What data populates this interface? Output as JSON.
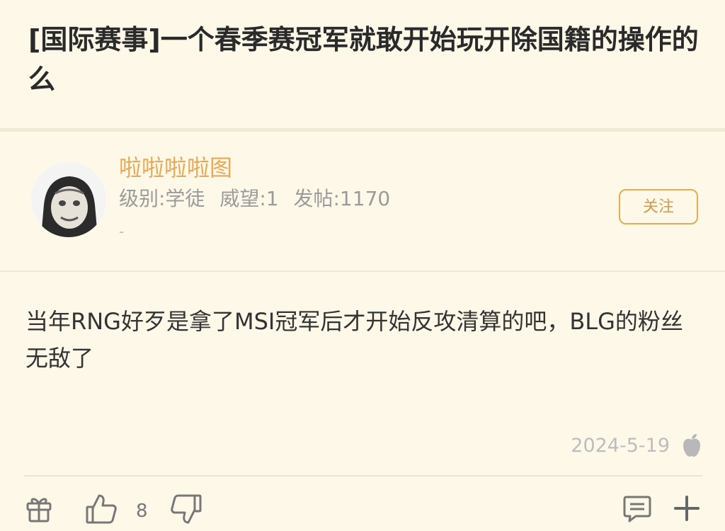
{
  "post": {
    "title": "[国际赛事]一个春季赛冠军就敢开始玩开除国籍的操作的么"
  },
  "author": {
    "name": "啦啦啦啦图",
    "level": "级别:学徒",
    "reputation": "威望:1",
    "posts": "发帖:1170",
    "signature": "-",
    "follow_label": "关注"
  },
  "reply": {
    "text": "当年RNG好歹是拿了MSI冠军后才开始反攻清算的吧，BLG的粉丝无敌了",
    "date": "2024-5-19",
    "device_icon": "apple-icon"
  },
  "actions": {
    "like_count": "8",
    "gift_icon": "gift-icon",
    "like_icon": "thumbs-up-icon",
    "dislike_icon": "thumbs-down-icon",
    "comment_icon": "comment-icon",
    "more_icon": "plus-icon"
  },
  "colors": {
    "background": "#fdf8e7",
    "accent": "#e8aa55",
    "text": "#333333",
    "muted": "#9b9b9b"
  }
}
